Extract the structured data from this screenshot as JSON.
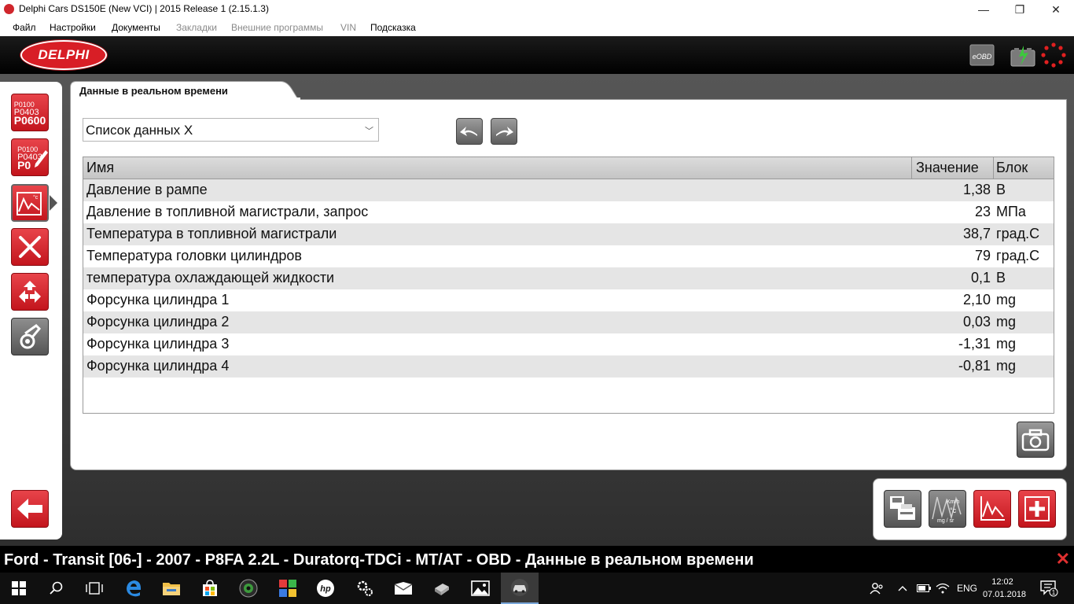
{
  "window": {
    "title": "Delphi Cars DS150E (New VCI) | 2015 Release 1 (2.15.1.3)",
    "minimize": "—",
    "maximize": "❐",
    "close": "✕"
  },
  "menu": {
    "items": [
      "Файл",
      "Настройки",
      "Документы",
      "Закладки",
      "Внешние программы",
      "VIN",
      "Подсказка"
    ]
  },
  "header": {
    "logo_text": "DELPHI",
    "eobd_label": "eOBD"
  },
  "left_toolbar": {
    "dtc_read_codes": [
      "P0100",
      "P0403",
      "P0600"
    ],
    "dtc_clear_codes": [
      "P0100",
      "P0403",
      "P0"
    ]
  },
  "tab": {
    "label": "Данные в реальном времени"
  },
  "dropdown": {
    "selected": "Список данных X"
  },
  "table": {
    "columns": {
      "name": "Имя",
      "value": "Значение",
      "unit": "Блок"
    },
    "rows": [
      {
        "name": "Давление в рампе",
        "value": "1,38",
        "unit": "В"
      },
      {
        "name": "Давление в топливной магистрали, запрос",
        "value": "23",
        "unit": "МПа"
      },
      {
        "name": "Температура в топливной магистрали",
        "value": "38,7",
        "unit": "град.С"
      },
      {
        "name": "Температура головки цилиндров",
        "value": "79",
        "unit": "град.С"
      },
      {
        "name": "температура охлаждающей жидкости",
        "value": "0,1",
        "unit": "В"
      },
      {
        "name": "Форсунка цилиндра 1",
        "value": "2,10",
        "unit": "mg"
      },
      {
        "name": "Форсунка цилиндра 2",
        "value": "0,03",
        "unit": "mg"
      },
      {
        "name": "Форсунка цилиндра 3",
        "value": "-1,31",
        "unit": "mg"
      },
      {
        "name": "Форсунка цилиндра 4",
        "value": "-0,81",
        "unit": "mg"
      }
    ]
  },
  "status": {
    "text": "Ford - Transit [06-] - 2007 - P8FA 2.2L - Duratorq-TDCi - MT/AT - OBD - Данные в реальном времени",
    "close": "✕"
  },
  "taskbar": {
    "language": "ENG",
    "time": "12:02",
    "date": "07.01.2018",
    "notifications": "1"
  },
  "colors": {
    "delphi_red": "#d81e26",
    "button_grey": "#6e6e6e",
    "status_bg": "#000000"
  }
}
